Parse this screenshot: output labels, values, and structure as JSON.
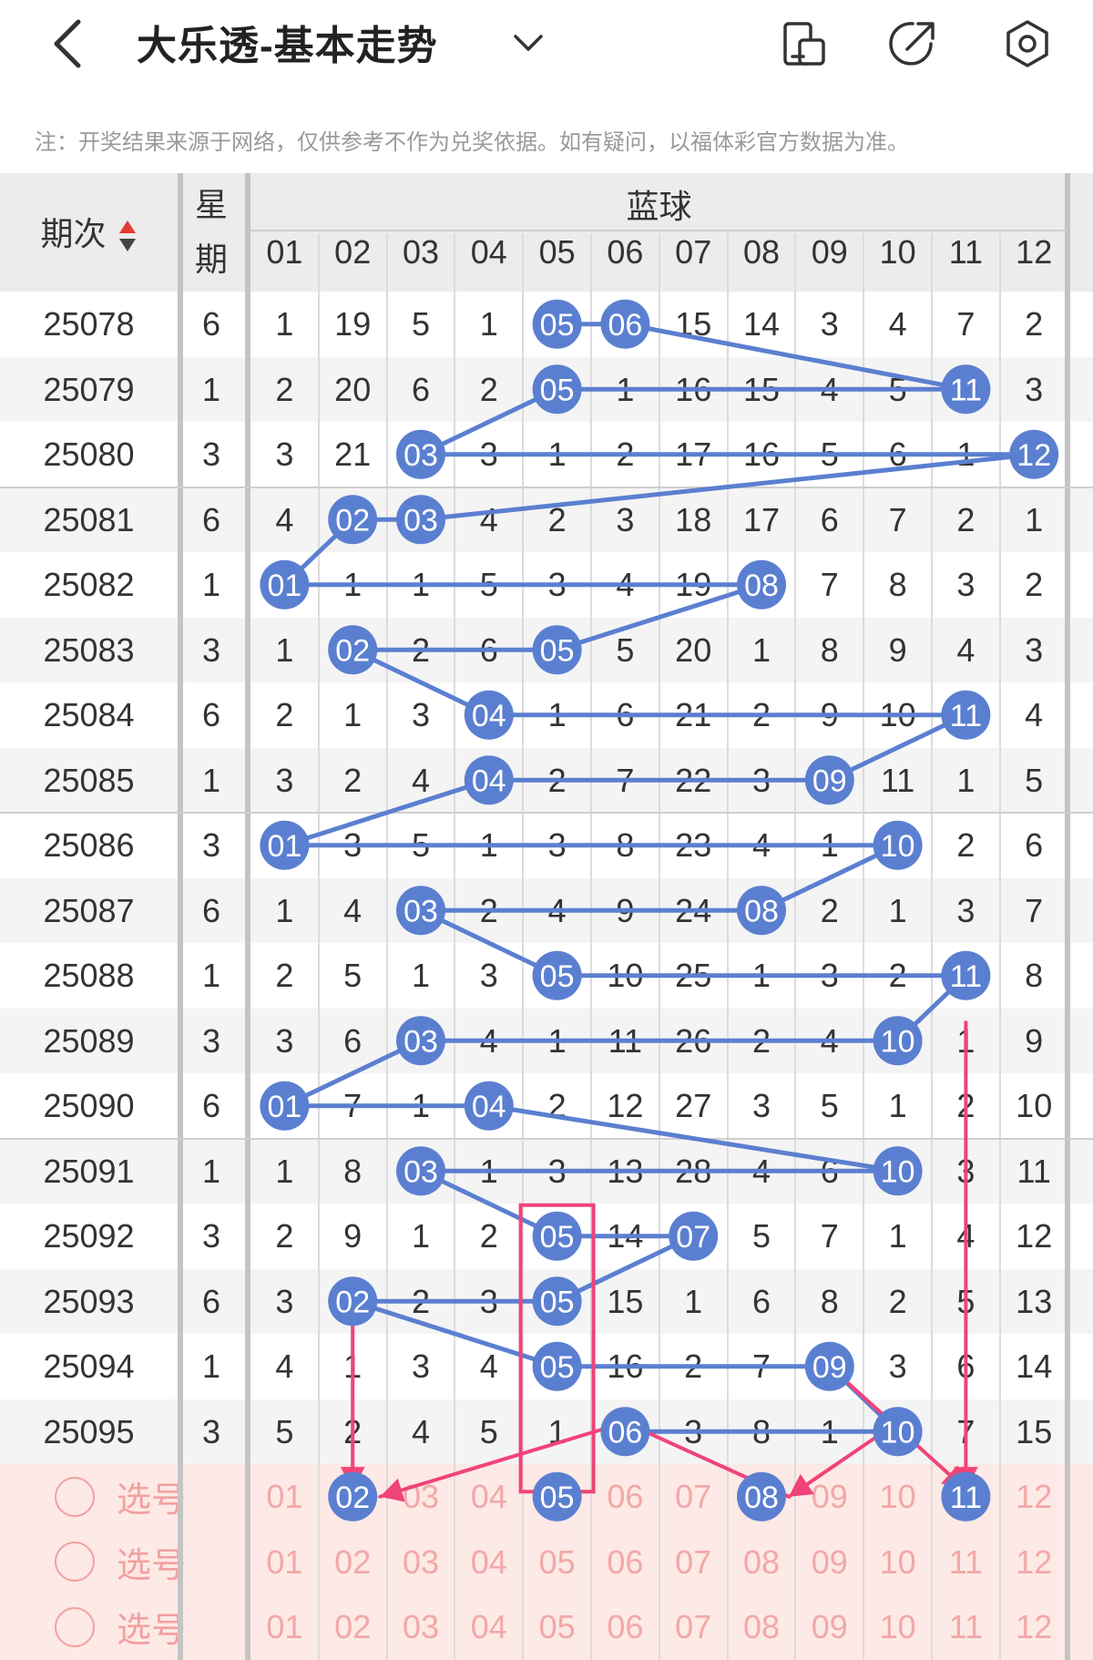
{
  "header": {
    "title": "大乐透-基本走势",
    "back_icon": "chevron-left-icon",
    "dropdown_icon": "chevron-down-icon",
    "icons": [
      "phone-rotate-icon",
      "share-icon",
      "settings-icon"
    ]
  },
  "notice": "注：开奖结果来源于网络，仅供参考不作为兑奖依据。如有疑问，以福体彩官方数据为准。",
  "table": {
    "col_issue": "期次",
    "col_week_1": "星",
    "col_week_2": "期",
    "group_label": "蓝球",
    "columns": [
      "01",
      "02",
      "03",
      "04",
      "05",
      "06",
      "07",
      "08",
      "09",
      "10",
      "11",
      "12"
    ],
    "rows": [
      {
        "issue": "25078",
        "week": "6",
        "cells": [
          "1",
          "19",
          "5",
          "1",
          "05",
          "06",
          "15",
          "14",
          "3",
          "4",
          "7",
          "2"
        ],
        "balls": [
          5,
          6
        ]
      },
      {
        "issue": "25079",
        "week": "1",
        "cells": [
          "2",
          "20",
          "6",
          "2",
          "05",
          "1",
          "16",
          "15",
          "4",
          "5",
          "11",
          "3"
        ],
        "balls": [
          5,
          11
        ]
      },
      {
        "issue": "25080",
        "week": "3",
        "cells": [
          "3",
          "21",
          "03",
          "3",
          "1",
          "2",
          "17",
          "16",
          "5",
          "6",
          "1",
          "12"
        ],
        "balls": [
          3,
          12
        ]
      },
      {
        "issue": "25081",
        "week": "6",
        "cells": [
          "4",
          "02",
          "03",
          "4",
          "2",
          "3",
          "18",
          "17",
          "6",
          "7",
          "2",
          "1"
        ],
        "balls": [
          2,
          3
        ]
      },
      {
        "issue": "25082",
        "week": "1",
        "cells": [
          "01",
          "1",
          "1",
          "5",
          "3",
          "4",
          "19",
          "08",
          "7",
          "8",
          "3",
          "2"
        ],
        "balls": [
          1,
          8
        ]
      },
      {
        "issue": "25083",
        "week": "3",
        "cells": [
          "1",
          "02",
          "2",
          "6",
          "05",
          "5",
          "20",
          "1",
          "8",
          "9",
          "4",
          "3"
        ],
        "balls": [
          2,
          5
        ]
      },
      {
        "issue": "25084",
        "week": "6",
        "cells": [
          "2",
          "1",
          "3",
          "04",
          "1",
          "6",
          "21",
          "2",
          "9",
          "10",
          "11",
          "4"
        ],
        "balls": [
          4,
          11
        ]
      },
      {
        "issue": "25085",
        "week": "1",
        "cells": [
          "3",
          "2",
          "4",
          "04",
          "2",
          "7",
          "22",
          "3",
          "09",
          "11",
          "1",
          "5"
        ],
        "balls": [
          4,
          9
        ]
      },
      {
        "issue": "25086",
        "week": "3",
        "cells": [
          "01",
          "3",
          "5",
          "1",
          "3",
          "8",
          "23",
          "4",
          "1",
          "10",
          "2",
          "6"
        ],
        "balls": [
          1,
          10
        ]
      },
      {
        "issue": "25087",
        "week": "6",
        "cells": [
          "1",
          "4",
          "03",
          "2",
          "4",
          "9",
          "24",
          "08",
          "2",
          "1",
          "3",
          "7"
        ],
        "balls": [
          3,
          8
        ]
      },
      {
        "issue": "25088",
        "week": "1",
        "cells": [
          "2",
          "5",
          "1",
          "3",
          "05",
          "10",
          "25",
          "1",
          "3",
          "2",
          "11",
          "8"
        ],
        "balls": [
          5,
          11
        ]
      },
      {
        "issue": "25089",
        "week": "3",
        "cells": [
          "3",
          "6",
          "03",
          "4",
          "1",
          "11",
          "26",
          "2",
          "4",
          "10",
          "1",
          "9"
        ],
        "balls": [
          3,
          10
        ]
      },
      {
        "issue": "25090",
        "week": "6",
        "cells": [
          "01",
          "7",
          "1",
          "04",
          "2",
          "12",
          "27",
          "3",
          "5",
          "1",
          "2",
          "10"
        ],
        "balls": [
          1,
          4
        ]
      },
      {
        "issue": "25091",
        "week": "1",
        "cells": [
          "1",
          "8",
          "03",
          "1",
          "3",
          "13",
          "28",
          "4",
          "6",
          "10",
          "3",
          "11"
        ],
        "balls": [
          3,
          10
        ]
      },
      {
        "issue": "25092",
        "week": "3",
        "cells": [
          "2",
          "9",
          "1",
          "2",
          "05",
          "14",
          "07",
          "5",
          "7",
          "1",
          "4",
          "12"
        ],
        "balls": [
          5,
          7
        ]
      },
      {
        "issue": "25093",
        "week": "6",
        "cells": [
          "3",
          "02",
          "2",
          "3",
          "05",
          "15",
          "1",
          "6",
          "8",
          "2",
          "5",
          "13"
        ],
        "balls": [
          2,
          5
        ]
      },
      {
        "issue": "25094",
        "week": "1",
        "cells": [
          "4",
          "1",
          "3",
          "4",
          "05",
          "16",
          "2",
          "7",
          "09",
          "3",
          "6",
          "14"
        ],
        "balls": [
          5,
          9
        ]
      },
      {
        "issue": "25095",
        "week": "3",
        "cells": [
          "5",
          "2",
          "4",
          "5",
          "1",
          "06",
          "3",
          "8",
          "1",
          "10",
          "7",
          "15"
        ],
        "balls": [
          6,
          10
        ]
      }
    ],
    "pick_label": "选号",
    "pick_rows": [
      {
        "selected": [
          2,
          5,
          8,
          11
        ]
      },
      {
        "selected": []
      },
      {
        "selected": []
      }
    ]
  },
  "colors": {
    "ball": "#5b7fd0",
    "trend_line": "#5b7fd0",
    "annotation": "#f0437a",
    "pick_bg": "#fde9e5",
    "pick_text": "#f2a8a8",
    "sort_up": "#e53935"
  }
}
